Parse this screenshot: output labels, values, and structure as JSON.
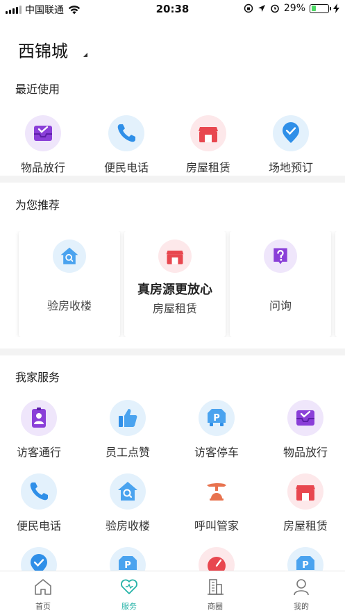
{
  "status_bar": {
    "carrier": "中国联通",
    "time": "20:38",
    "battery": "29%",
    "battery_level": 0.29
  },
  "city": "西锦城",
  "recent": {
    "title": "最近使用",
    "items": [
      {
        "label": "物品放行",
        "icon": "inbox-icon"
      },
      {
        "label": "便民电话",
        "icon": "phone-icon"
      },
      {
        "label": "房屋租赁",
        "icon": "store-icon"
      },
      {
        "label": "场地预订",
        "icon": "location-check-icon"
      }
    ]
  },
  "recommend": {
    "title": "为您推荐",
    "cards": [
      {
        "heading": "",
        "label": "验房收楼",
        "icon": "house-search-icon"
      },
      {
        "heading": "真房源更放心",
        "label": "房屋租赁",
        "icon": "store-icon"
      },
      {
        "heading": "",
        "label": "问询",
        "icon": "question-icon"
      }
    ]
  },
  "services": {
    "title": "我家服务",
    "items": [
      {
        "label": "访客通行",
        "icon": "visitor-badge-icon"
      },
      {
        "label": "员工点赞",
        "icon": "thumbs-up-icon"
      },
      {
        "label": "访客停车",
        "icon": "parking-icon"
      },
      {
        "label": "物品放行",
        "icon": "inbox-icon"
      },
      {
        "label": "便民电话",
        "icon": "phone-icon"
      },
      {
        "label": "验房收楼",
        "icon": "house-search-icon"
      },
      {
        "label": "呼叫管家",
        "icon": "bell-hand-icon"
      },
      {
        "label": "房屋租赁",
        "icon": "store-icon"
      }
    ]
  },
  "tabbar": {
    "items": [
      {
        "label": "首页",
        "icon": "home-icon"
      },
      {
        "label": "服务",
        "icon": "heart-icon",
        "active": true
      },
      {
        "label": "商圈",
        "icon": "building-icon"
      },
      {
        "label": "我的",
        "icon": "person-icon"
      }
    ]
  },
  "colors": {
    "accent": "#26b3a8",
    "purple": "#8a3fd8",
    "blue": "#2f8fe8",
    "red": "#e8474f"
  }
}
